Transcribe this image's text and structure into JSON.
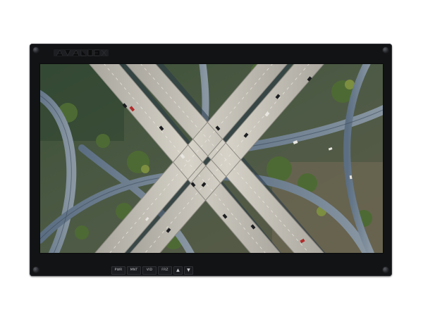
{
  "monitor": {
    "brand_logo": "AVALUE"
  },
  "controls": {
    "buttons": [
      "PWR",
      "MNT",
      "VID",
      "FRZ"
    ],
    "up_arrow": "▲",
    "down_arrow": "▼"
  },
  "colors": {
    "bezel": "#121315",
    "road": "#bfbcb5",
    "vegetation": "#3f5a2f",
    "shadow": "#2a3a4a"
  },
  "screen": {
    "icon": "highway-interchange-aerial-image"
  }
}
